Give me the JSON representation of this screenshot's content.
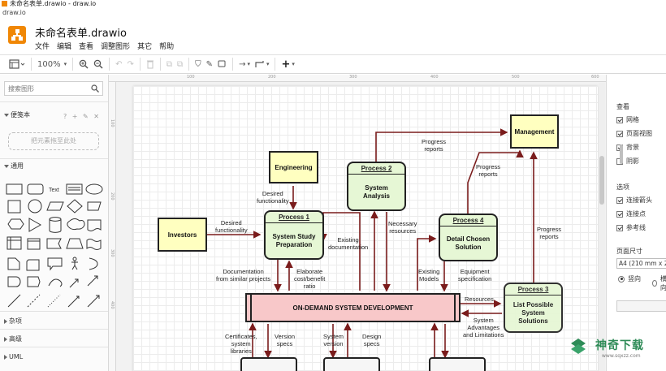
{
  "window": {
    "title": "未命名表单.drawio - draw.io",
    "tab": "draw.io"
  },
  "header": {
    "doc_title": "未命名表单.drawio",
    "menu": [
      "文件",
      "编辑",
      "查看",
      "调整图形",
      "其它",
      "帮助"
    ]
  },
  "toolbar": {
    "zoom": "100%"
  },
  "left_panel": {
    "search_placeholder": "搜索图形",
    "scratchpad": "便笺本",
    "scratchpad_tools": "? + ✎ ✕",
    "drop_hint": "把元素拖至此处",
    "general": "通用",
    "misc": "杂项",
    "advanced": "高级",
    "uml": "UML",
    "text_shape": "Text"
  },
  "right_panel": {
    "view_title": "查看",
    "view_options": [
      {
        "label": "网格",
        "checked": true
      },
      {
        "label": "页面视图",
        "checked": true
      },
      {
        "label": "背景",
        "checked": true
      },
      {
        "label": "阴影",
        "checked": false
      }
    ],
    "options_title": "选项",
    "options": [
      {
        "label": "连接箭头",
        "checked": true
      },
      {
        "label": "连接点",
        "checked": true
      },
      {
        "label": "参考线",
        "checked": true
      }
    ],
    "page_size_title": "页面尺寸",
    "page_size": "A4 (210 mm x 297 mm)",
    "orientation": [
      "竖向",
      "横向"
    ]
  },
  "ruler_ticks": [
    "100",
    "200",
    "300",
    "400",
    "500",
    "600"
  ],
  "ruler_left_ticks": [
    "100",
    "200",
    "300",
    "400"
  ],
  "diagram": {
    "nodes": {
      "management": "Management",
      "engineering": "Engineering",
      "investors": "Investors",
      "p1_title": "Process 1",
      "p1_body": "System Study Preparation",
      "p2_title": "Process 2",
      "p2_body": "System Analysis",
      "p3_title": "Process 3",
      "p3_body": "List Possible System Solutions",
      "p4_title": "Process 4",
      "p4_body": "Detail Chosen Solution",
      "center": "ON-DEMAND SYSTEM DEVELOPMENT"
    },
    "labels": {
      "progress_reports_top": "Progress\nreports",
      "progress_reports_mid": "Progress\nreports",
      "progress_reports_right": "Progress\nreports",
      "desired_func_1": "Desired\nfunctionality",
      "desired_func_2": "Desired\nfunctionality",
      "necessary_resources": "Necessary\nresources",
      "existing_doc": "Existing\ndocumentation",
      "documentation": "Documentation\nfrom similar projects",
      "elaborate": "Elaborate\ncost/benefit\nratio",
      "existing_models": "Existing\nModels",
      "equipment": "Equipment\nspecification",
      "resources": "Resources",
      "advantages": "System\nAdvantages\nand Limitations",
      "certificates": "Certificates,\nsystem\nlibraries",
      "version_specs": "Version\nspecs",
      "system_version": "System\nversion",
      "design_specs": "Design\nspecs"
    }
  },
  "watermark": {
    "title": "神奇下载",
    "url": "www.sqxzz.com"
  },
  "colors": {
    "brand": "#f08705",
    "yellow": "#ffffc0",
    "green": "#e6f7d5",
    "pink": "#f8c8c9",
    "arrow": "#7a1c1c"
  }
}
